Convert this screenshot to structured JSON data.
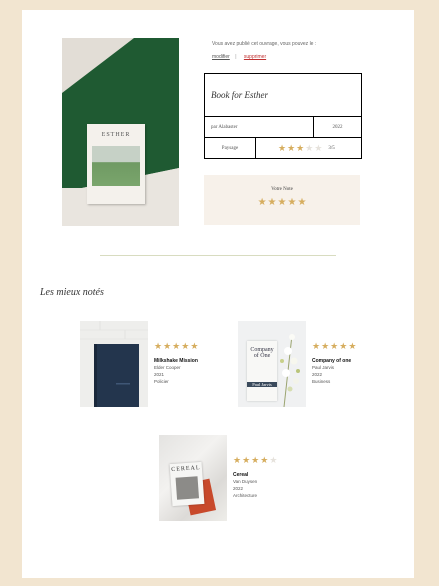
{
  "book": {
    "cover_title": "ESTHER",
    "owner_text": "Vous avez publié cet ouvrage, vous pouvez le :",
    "modify_label": "modifier",
    "separator": "|",
    "delete_label": "supprimer",
    "title": "Book for Esther",
    "author": "par Alabaster",
    "year": "2022",
    "genre": "Paysage",
    "rating": 3,
    "rating_text": "3/5"
  },
  "vote": {
    "label": "Votre Note",
    "value": 5
  },
  "section_title": "Les mieux notés",
  "best": [
    {
      "name": "Milkshake Mission",
      "author": "Elder Cooper",
      "year": "2021",
      "genre": "Policier",
      "rating": 5
    },
    {
      "name": "Company of one",
      "author": "Paul Jarvis",
      "year": "2022",
      "genre": "Business",
      "rating": 5,
      "cover_line1": "Company",
      "cover_line2": "of One",
      "cover_author": "Paul Jarvis"
    },
    {
      "name": "Cereal",
      "author": "Van Duysen",
      "year": "2022",
      "genre": "Architecture",
      "rating": 4,
      "cover_line1": "CEREAL"
    }
  ],
  "colors": {
    "background": "#f2e5d0",
    "star": "#d6ad5e",
    "delete_link": "#c03030",
    "vote_bg": "#f7f1ea"
  }
}
